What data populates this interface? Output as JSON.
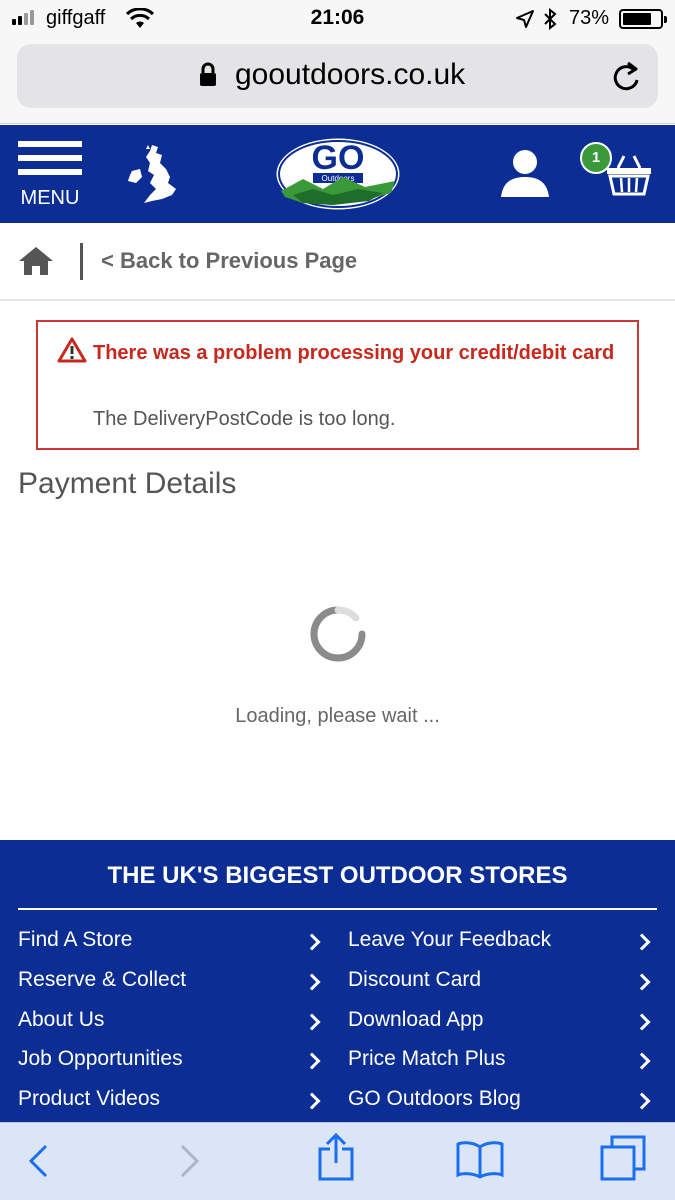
{
  "status_bar": {
    "carrier": "giffgaff",
    "time": "21:06",
    "battery_percent": "73%",
    "battery_level": 0.73,
    "icons": [
      "signal-icon",
      "wifi-icon",
      "location-arrow-icon",
      "bluetooth-icon",
      "battery-icon"
    ]
  },
  "browser": {
    "url": "gooutdoors.co.uk",
    "toolbar": [
      "back-icon",
      "forward-icon",
      "share-icon",
      "bookmarks-icon",
      "tabs-icon"
    ]
  },
  "header": {
    "menu_label": "MENU",
    "logo_line1": "GO",
    "logo_line2": "Outdoors",
    "basket_count": "1",
    "brand_color": "#0b2d94",
    "badge_color": "#3a9a3a"
  },
  "breadcrumb": {
    "back_label": "< Back to Previous Page"
  },
  "error": {
    "title": "There was a problem processing your credit/debit card",
    "message": "The DeliveryPostCode is too long.",
    "color": "#c8281d"
  },
  "main": {
    "heading": "Payment Details",
    "loading_text": "Loading, please wait ..."
  },
  "footer": {
    "title": "THE UK'S BIGGEST OUTDOOR STORES",
    "links_left": [
      "Find A Store",
      "Reserve & Collect",
      "About Us",
      "Job Opportunities",
      "Product Videos"
    ],
    "links_right": [
      "Leave Your Feedback",
      "Discount Card",
      "Download App",
      "Price Match Plus",
      "GO Outdoors Blog"
    ]
  }
}
